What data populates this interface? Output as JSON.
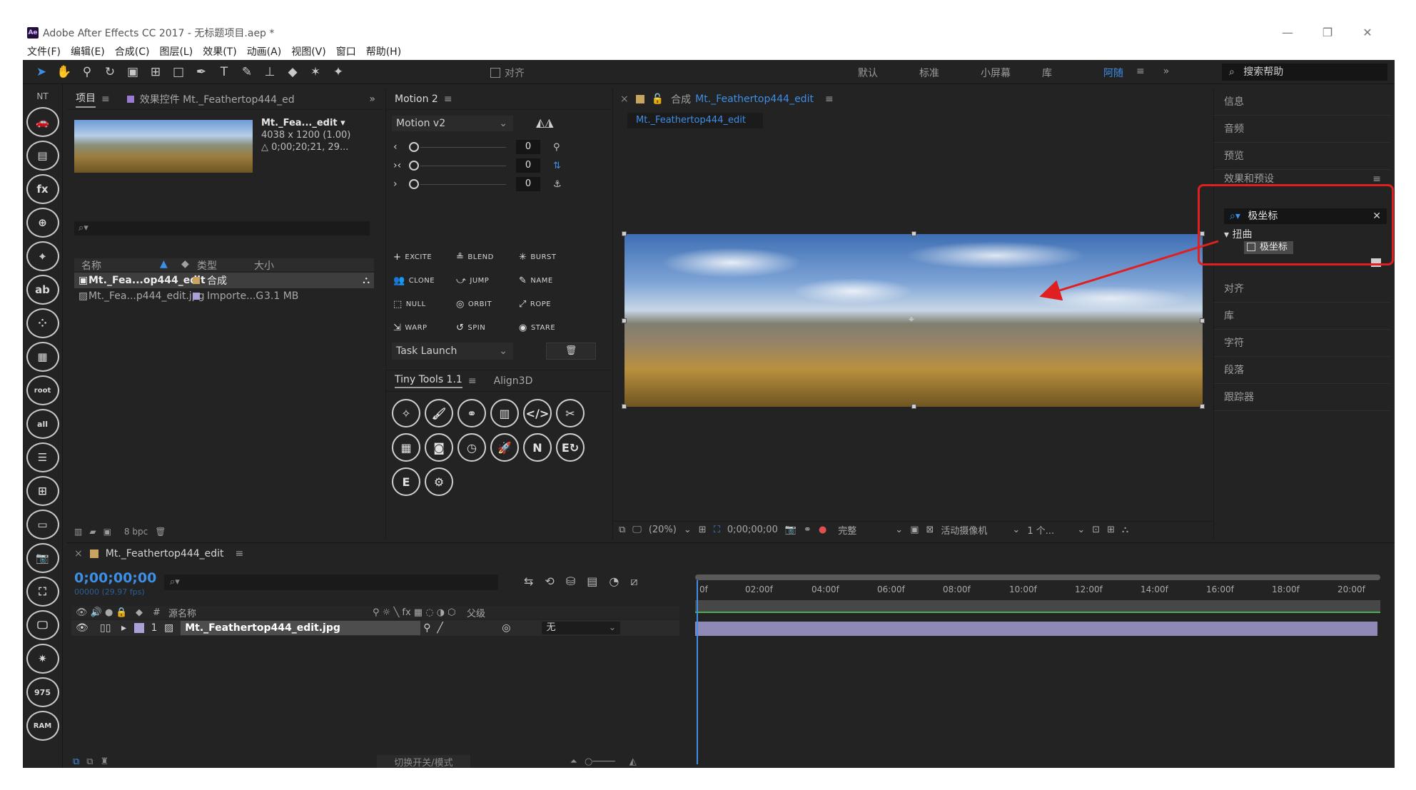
{
  "window": {
    "title": "Adobe After Effects CC 2017 - 无标题项目.aep *",
    "logo": "Ae",
    "controls": [
      "—",
      "❐",
      "✕"
    ]
  },
  "menu": [
    "文件(F)",
    "编辑(E)",
    "合成(C)",
    "图层(L)",
    "效果(T)",
    "动画(A)",
    "视图(V)",
    "窗口",
    "帮助(H)"
  ],
  "toolbar": {
    "align_label": "对齐",
    "workspaces": [
      "默认",
      "标准",
      "小屏幕",
      "库",
      "阿随"
    ],
    "active_workspace": "阿随",
    "search_help": "搜索帮助"
  },
  "rail": {
    "header": "NT",
    "icons": [
      "car-icon",
      "layers-icon",
      "fx",
      "image-add-icon",
      "target-icon",
      "text-icon",
      "dots-icon",
      "grid-icon",
      "root",
      "all",
      "lines-icon",
      "layout-icon",
      "screen-icon",
      "camera-icon",
      "transform-icon",
      "monitor-icon",
      "star-icon",
      "975",
      "RAM"
    ]
  },
  "project": {
    "tabs": [
      "项目",
      "效果控件 Mt._Feathertop444_ed"
    ],
    "item_name": "Mt._Fea..._edit ▾",
    "item_dims": "4038 x 1200 (1.00)",
    "item_duration": "△ 0;00;20;21, 29...",
    "columns": [
      "名称",
      "类型",
      "大小"
    ],
    "rows": [
      {
        "name": "Mt._Fea...op444_edit",
        "type": "合成",
        "size": ""
      },
      {
        "name": "Mt._Fea...p444_edit.jpg",
        "type": "Importe...G",
        "size": "3.1 MB"
      }
    ],
    "bpc": "8 bpc"
  },
  "motion": {
    "tab": "Motion 2",
    "version": "Motion v2",
    "values": [
      "0",
      "0",
      "0"
    ],
    "buttons": [
      "EXCITE",
      "BLEND",
      "BURST",
      "CLONE",
      "JUMP",
      "NAME",
      "NULL",
      "ORBIT",
      "ROPE",
      "WARP",
      "SPIN",
      "STARE"
    ],
    "task": "Task Launch"
  },
  "tinytools": {
    "tabs": [
      "Tiny Tools 1.1",
      "Align3D"
    ]
  },
  "comp": {
    "tab_prefix": "合成",
    "tab_name": "Mt._Feathertop444_edit",
    "subtab": "Mt._Feathertop444_edit",
    "zoom": "(20%)",
    "timecode": "0;00;00;00",
    "quality": "完整",
    "camera": "活动摄像机",
    "views": "1 个..."
  },
  "right_panel": {
    "sections_top": [
      "信息",
      "音频",
      "预览",
      "效果和预设"
    ],
    "search_value": "极坐标",
    "category": "扭曲",
    "effect": "极坐标",
    "sections_bottom": [
      "对齐",
      "库",
      "字符",
      "段落",
      "跟踪器"
    ]
  },
  "timeline": {
    "tab": "Mt._Feathertop444_edit",
    "timecode": "0;00;00;00",
    "fps": "00000 (29.97 fps)",
    "header_source": "源名称",
    "header_parent": "父级",
    "header_num": "#",
    "layer_index": "1",
    "layer_name": "Mt._Feathertop444_edit.jpg",
    "layer_parent": "无",
    "ticks": [
      "0f",
      "02:00f",
      "04:00f",
      "06:00f",
      "08:00f",
      "10:00f",
      "12:00f",
      "14:00f",
      "16:00f",
      "18:00f",
      "20:00f"
    ],
    "footer": "切换开关/模式"
  },
  "colors": {
    "accent": "#3d8ee6",
    "highlight": "#e02020",
    "panel": "#232323"
  }
}
